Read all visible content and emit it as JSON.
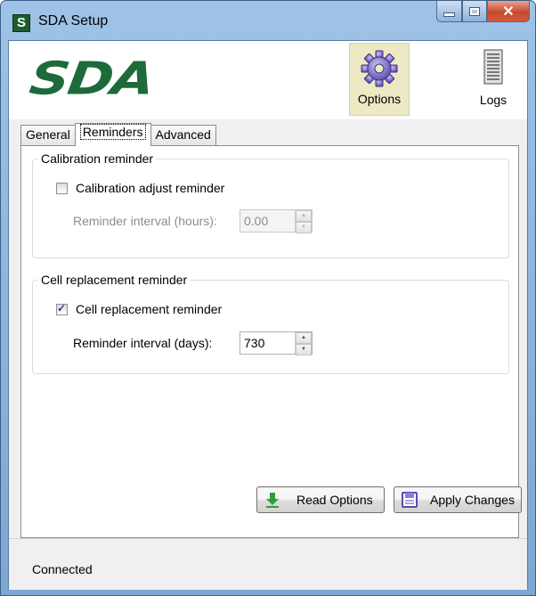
{
  "window": {
    "icon_letter": "S",
    "title": "SDA Setup",
    "controls": {
      "minimize": "minimize",
      "maximize": "maximize",
      "close": "✕"
    }
  },
  "header": {
    "logo_text": "SDA",
    "buttons": [
      {
        "label": "Options",
        "icon": "gear-icon",
        "selected": true
      },
      {
        "label": "Logs",
        "icon": "document-icon",
        "selected": false
      }
    ]
  },
  "tabs": [
    {
      "label": "General",
      "active": false
    },
    {
      "label": "Reminders",
      "active": true
    },
    {
      "label": "Advanced",
      "active": false
    }
  ],
  "calibration": {
    "group_title": "Calibration reminder",
    "checkbox_label": "Calibration adjust reminder",
    "checked": false,
    "interval_label": "Reminder interval (hours):",
    "interval_value": "0.00",
    "enabled": false
  },
  "cell": {
    "group_title": "Cell replacement reminder",
    "checkbox_label": "Cell replacement reminder",
    "checked": true,
    "interval_label": "Reminder interval (days):",
    "interval_value": "730",
    "enabled": true
  },
  "actions": {
    "read_label": "Read Options",
    "apply_label": "Apply Changes"
  },
  "status": {
    "text": "Connected"
  },
  "colors": {
    "logo": "#1d6b3a",
    "selected_button": "#ece9c4",
    "close_button": "#c6492d"
  }
}
